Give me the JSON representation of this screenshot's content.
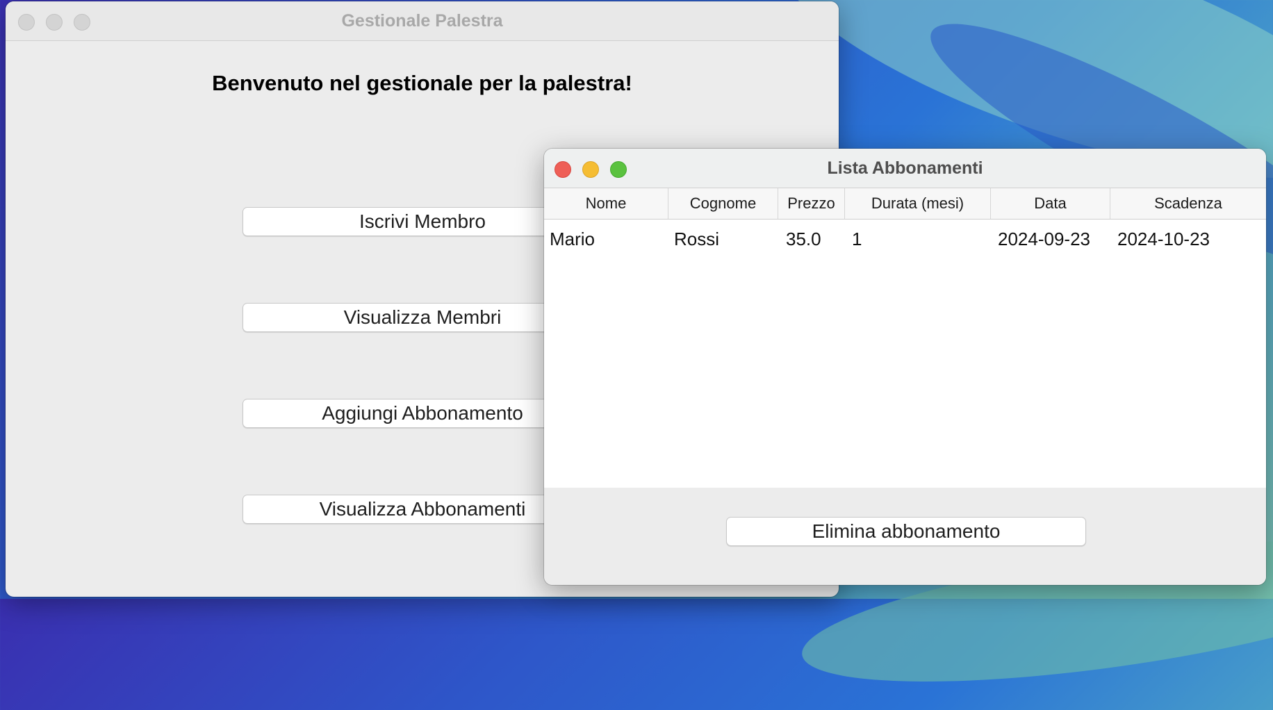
{
  "main_window": {
    "title": "Gestionale Palestra",
    "welcome": "Benvenuto nel gestionale per la palestra!",
    "buttons": {
      "iscrivi": "Iscrivi Membro",
      "visualizza_membri": "Visualizza Membri",
      "aggiungi_abbonamento": "Aggiungi Abbonamento",
      "visualizza_abbonamenti": "Visualizza Abbonamenti"
    }
  },
  "list_window": {
    "title": "Lista Abbonamenti",
    "columns": [
      "Nome",
      "Cognome",
      "Prezzo",
      "Durata (mesi)",
      "Data",
      "Scadenza"
    ],
    "rows": [
      [
        "Mario",
        "Rossi",
        "35.0",
        "1",
        "2024-09-23",
        "2024-10-23"
      ]
    ],
    "delete_button": "Elimina abbonamento"
  },
  "colors": {
    "close": "#ee5f57",
    "minimize": "#f5bd33",
    "maximize": "#5ac23f"
  }
}
